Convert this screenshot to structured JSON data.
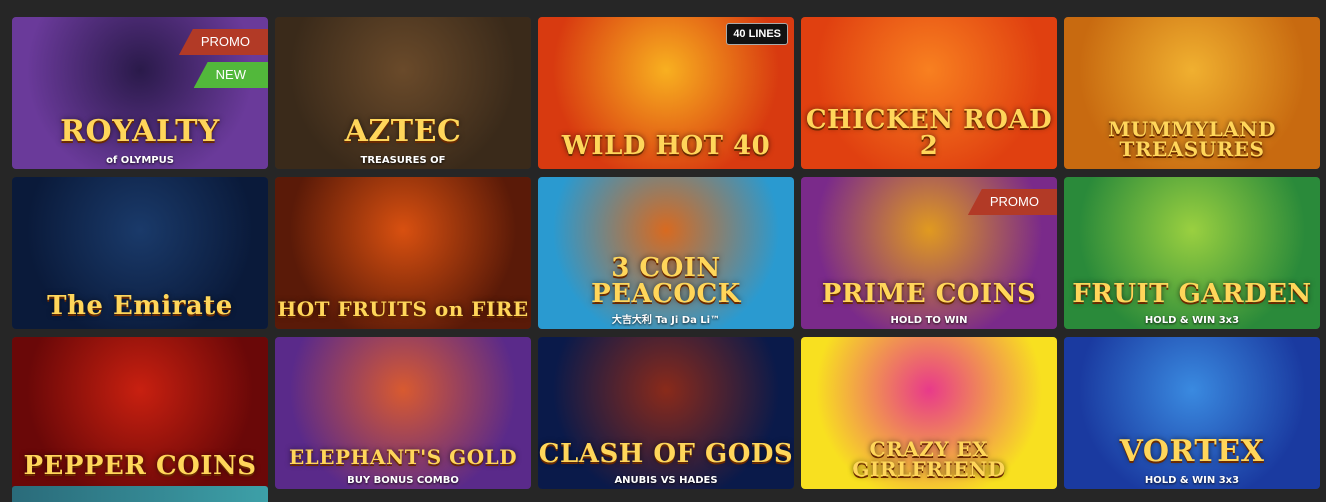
{
  "games": [
    {
      "title": "ROYALTY",
      "subtitle": "of OLYMPUS",
      "badges": [
        "PROMO",
        "NEW"
      ],
      "bg": [
        "#6a3a9a",
        "#2a1a4a"
      ]
    },
    {
      "title": "AZTEC",
      "subtitle": "TREASURES OF",
      "badges": [],
      "bg": [
        "#3a2a1a",
        "#6a4a2a"
      ]
    },
    {
      "title": "WILD HOT 40",
      "subtitle": "",
      "badges": [
        "40 LINES"
      ],
      "bg": [
        "#d83a10",
        "#f8b020"
      ]
    },
    {
      "title": "CHICKEN ROAD 2",
      "subtitle": "",
      "badges": [],
      "bg": [
        "#e04010",
        "#f88020"
      ]
    },
    {
      "title": "MUMMYLAND TREASURES",
      "subtitle": "",
      "badges": [],
      "bg": [
        "#c86a10",
        "#f0b030"
      ]
    },
    {
      "title": "The Emirate",
      "subtitle": "",
      "badges": [],
      "bg": [
        "#0a1a3a",
        "#1a3a6a"
      ]
    },
    {
      "title": "HOT FRUITS on FIRE",
      "subtitle": "",
      "badges": [],
      "bg": [
        "#5a1a08",
        "#d85010"
      ]
    },
    {
      "title": "3 COIN PEACOCK",
      "subtitle": "大吉大利 Ta Ji Da Li™",
      "badges": [],
      "bg": [
        "#2a9ad0",
        "#d86a20"
      ]
    },
    {
      "title": "PRIME COINS",
      "subtitle": "HOLD TO WIN",
      "badges": [
        "PROMO"
      ],
      "bg": [
        "#7a2a8a",
        "#e09a20"
      ]
    },
    {
      "title": "FRUIT GARDEN",
      "subtitle": "HOLD & WIN 3x3",
      "badges": [],
      "bg": [
        "#2a8a3a",
        "#9ad040"
      ]
    },
    {
      "title": "PEPPER COINS",
      "subtitle": "",
      "badges": [],
      "bg": [
        "#6a0808",
        "#c82010"
      ]
    },
    {
      "title": "ELEPHANT'S GOLD",
      "subtitle": "BUY BONUS COMBO",
      "badges": [],
      "bg": [
        "#5a2a8a",
        "#d85a30"
      ]
    },
    {
      "title": "CLASH OF GODS",
      "subtitle": "ANUBIS VS HADES",
      "badges": [],
      "bg": [
        "#0a1a4a",
        "#8a2a1a"
      ]
    },
    {
      "title": "CRAZY EX GIRLFRIEND",
      "subtitle": "",
      "badges": [],
      "bg": [
        "#f8e020",
        "#e83a8a"
      ]
    },
    {
      "title": "VORTEX",
      "subtitle": "HOLD & WIN 3x3",
      "badges": [],
      "bg": [
        "#1a3aa0",
        "#3a8ae0"
      ]
    }
  ]
}
